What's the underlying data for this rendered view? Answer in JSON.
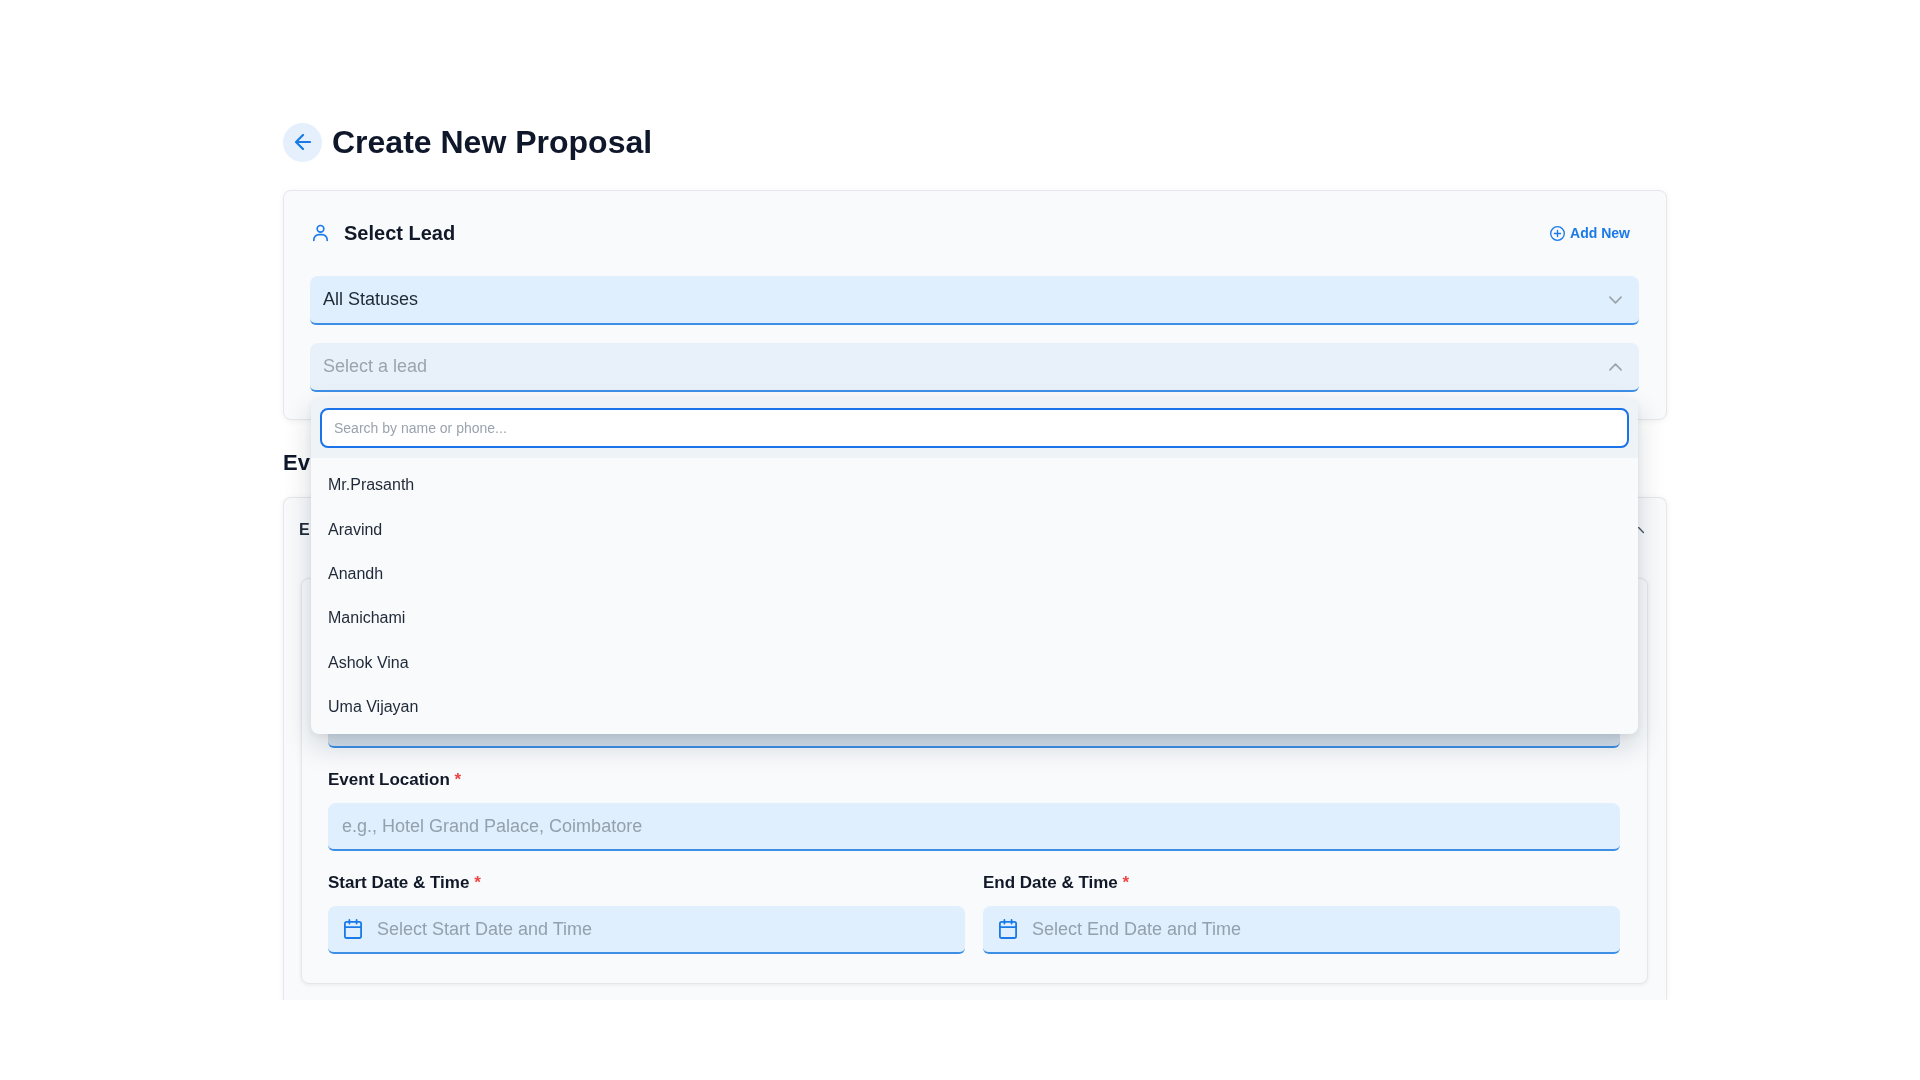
{
  "page": {
    "title": "Create New Proposal"
  },
  "lead_section": {
    "title": "Select Lead",
    "add_new": "Add New",
    "status_filter": {
      "value": "All Statuses",
      "expanded": false
    },
    "lead_select": {
      "placeholder": "Select a lead",
      "expanded": true,
      "search": {
        "placeholder": "Search by name or phone..."
      },
      "options": [
        {
          "label": "Mr.Prasanth",
          "selected": false
        },
        {
          "label": "Aravind",
          "selected": false
        },
        {
          "label": "Anandh",
          "selected": false
        },
        {
          "label": "Manichami",
          "selected": false
        },
        {
          "label": "Ashok Vina",
          "selected": false
        },
        {
          "label": "Uma Vijayan",
          "selected": false
        }
      ]
    }
  },
  "event_section": {
    "heading": "Ev",
    "card_title": "E",
    "location": {
      "label": "Event Location",
      "required_mark": "*",
      "placeholder": "e.g., Hotel Grand Palace, Coimbatore"
    },
    "dates": [
      {
        "label": "Start Date & Time",
        "required_mark": "*",
        "placeholder": "Select Start Date and Time"
      },
      {
        "label": "End Date & Time",
        "required_mark": "*",
        "placeholder": "Select End Date and Time"
      }
    ]
  }
}
